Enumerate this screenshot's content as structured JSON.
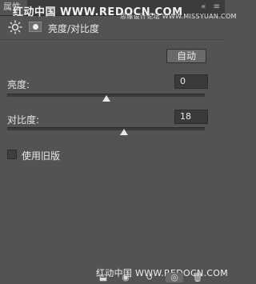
{
  "panel": {
    "tab_label": "属性",
    "title": "亮度/对比度",
    "auto_label": "自动"
  },
  "watermarks": {
    "top": "红动中国 WWW.REDOCN.COM",
    "top_right": "思缘设计论坛 WWW.MISSYUAN.COM",
    "bottom": "红动中国 WWW.REDOCN.COM"
  },
  "brightness": {
    "label": "亮度:",
    "value": "0",
    "slider_fraction": 0.5
  },
  "contrast": {
    "label": "对比度:",
    "value": "18",
    "slider_fraction": 0.59
  },
  "legacy": {
    "label": "使用旧版",
    "checked": false
  },
  "icons": {
    "adjustment": "sun-icon",
    "mask": "mask-icon",
    "tab_controls": [
      "collapse-icon",
      "menu-icon"
    ],
    "bottom": [
      "clip-to-layer-icon",
      "view-previous-icon",
      "reset-icon",
      "visibility-eye-icon",
      "delete-trash-icon"
    ]
  }
}
